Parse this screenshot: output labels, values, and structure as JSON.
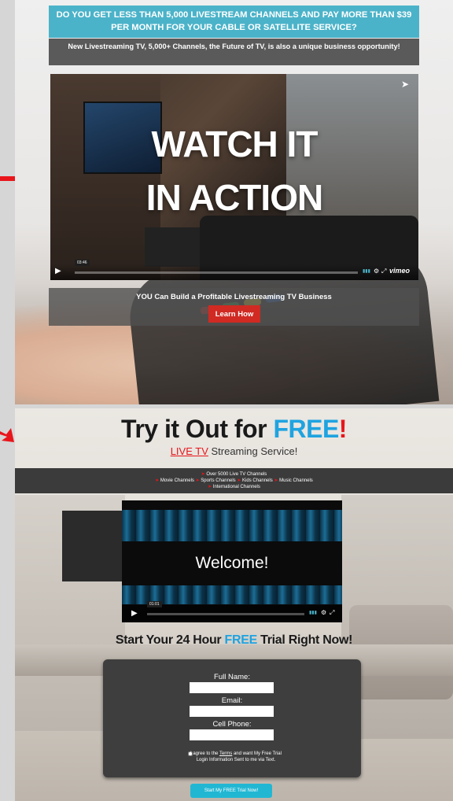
{
  "top": {
    "banner": "DO YOU GET LESS THAN 5,000 LIVESTREAM CHANNELS AND PAY MORE THAN $39 PER MONTH FOR YOUR CABLE OR SATELLITE SERVICE?",
    "subbanner": "New Livestreaming TV, 5,000+ Channels, the Future of TV, is also a unique business opportunity!",
    "video": {
      "overlay_line1": "WATCH IT",
      "overlay_line2": "IN ACTION",
      "time": "03:46",
      "brand": "vimeo"
    },
    "cta": {
      "text": "YOU Can Build a Profitable Livestreaming TV Business",
      "button": "Learn How"
    }
  },
  "bottom": {
    "headline_pre": "Try it Out for ",
    "headline_free": "FREE",
    "headline_post": "!",
    "tagline_live": "LIVE TV",
    "tagline_rest": " Streaming Service!",
    "channels": {
      "line1": "Over 5000 Live TV Channels",
      "line2_items": [
        "Movie Channels",
        "Sports Channels",
        "Kids Channels",
        "Music Channels"
      ],
      "line3": "International Channels"
    },
    "video": {
      "title": "Welcome!",
      "time": "01:01"
    },
    "start_pre": "Start Your 24 Hour ",
    "start_free": "FREE",
    "start_post": " Trial Right Now!",
    "form": {
      "full_name_label": "Full Name:",
      "email_label": "Email:",
      "phone_label": "Cell Phone:",
      "agree_pre": "I agree to the ",
      "agree_terms": "Terms",
      "agree_post": " and want My Free Trial Login Information Sent to me via Text.",
      "submit": "Start My FREE Trial Now!"
    }
  },
  "colors": {
    "accent_blue": "#4bb3c9",
    "cta_red": "#d02a22",
    "free_blue": "#1fa3e0",
    "arrow_red": "#e8151b"
  }
}
